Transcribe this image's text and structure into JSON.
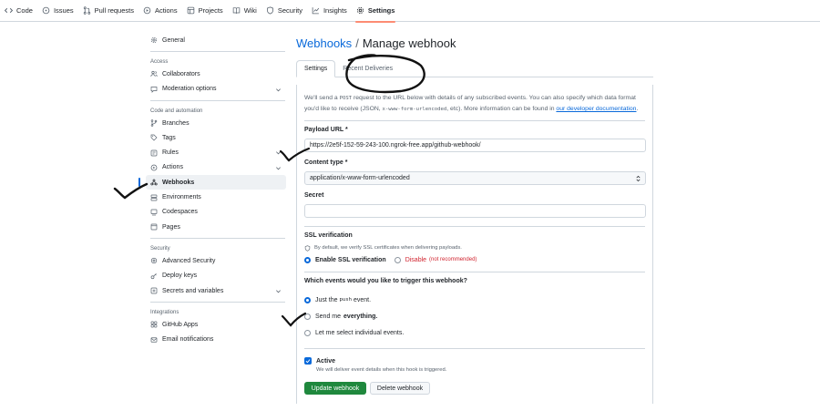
{
  "repo_nav": {
    "items": [
      {
        "label": "Code",
        "icon": "code-icon"
      },
      {
        "label": "Issues",
        "icon": "issue-icon"
      },
      {
        "label": "Pull requests",
        "icon": "pull-request-icon"
      },
      {
        "label": "Actions",
        "icon": "play-icon"
      },
      {
        "label": "Projects",
        "icon": "table-icon"
      },
      {
        "label": "Wiki",
        "icon": "book-icon"
      },
      {
        "label": "Security",
        "icon": "shield-icon"
      },
      {
        "label": "Insights",
        "icon": "graph-icon"
      },
      {
        "label": "Settings",
        "icon": "gear-icon"
      }
    ],
    "selected": "Settings"
  },
  "sidebar": {
    "general": "General",
    "access_heading": "Access",
    "collaborators": "Collaborators",
    "moderation": "Moderation options",
    "code_heading": "Code and automation",
    "branches": "Branches",
    "tags": "Tags",
    "rules": "Rules",
    "actions": "Actions",
    "webhooks": "Webhooks",
    "environments": "Environments",
    "codespaces": "Codespaces",
    "pages": "Pages",
    "security_heading": "Security",
    "advanced_security": "Advanced Security",
    "deploy_keys": "Deploy keys",
    "secrets": "Secrets and variables",
    "integrations_heading": "Integrations",
    "github_apps": "GitHub Apps",
    "email_notifications": "Email notifications"
  },
  "main": {
    "breadcrumb": "Webhooks",
    "separator": "/",
    "title": "Manage webhook",
    "tabs": {
      "settings": "Settings",
      "recent_deliveries": "Recent Deliveries"
    },
    "intro": {
      "part1": "We'll send a ",
      "code1": "POST",
      "part2": " request to the URL below with details of any subscribed events. You can also specify which data format you'd like to receive (JSON, ",
      "code2": "x-www-form-urlencoded",
      "part3": ", etc). More information can be found in ",
      "link": "our developer documentation",
      "part4": "."
    },
    "payload_label": "Payload URL *",
    "payload_value": "https://2e5f-152-59-243-100.ngrok-free.app/github-webhook/",
    "content_type_label": "Content type *",
    "content_type_value": "application/x-www-form-urlencoded",
    "secret_label": "Secret",
    "secret_value": "",
    "ssl_label": "SSL verification",
    "ssl_hint": "By default, we verify SSL certificates when delivering payloads.",
    "ssl_enable": "Enable SSL verification",
    "ssl_disable": "Disable",
    "ssl_disable_note": "(not recommended)",
    "events_label": "Which events would you like to trigger this webhook?",
    "event_just_push_a": "Just the",
    "event_just_push_code": "push",
    "event_just_push_b": "event.",
    "event_everything_a": "Send me",
    "event_everything_b": "everything.",
    "event_individual": "Let me select individual events.",
    "active_label": "Active",
    "active_desc": "We will deliver event details when this hook is triggered.",
    "update_button": "Update webhook",
    "delete_button": "Delete webhook"
  },
  "colors": {
    "accent": "#0969da",
    "selected_underline": "#fd8c73",
    "primary_button": "#1f883d",
    "danger": "#d1242f"
  }
}
